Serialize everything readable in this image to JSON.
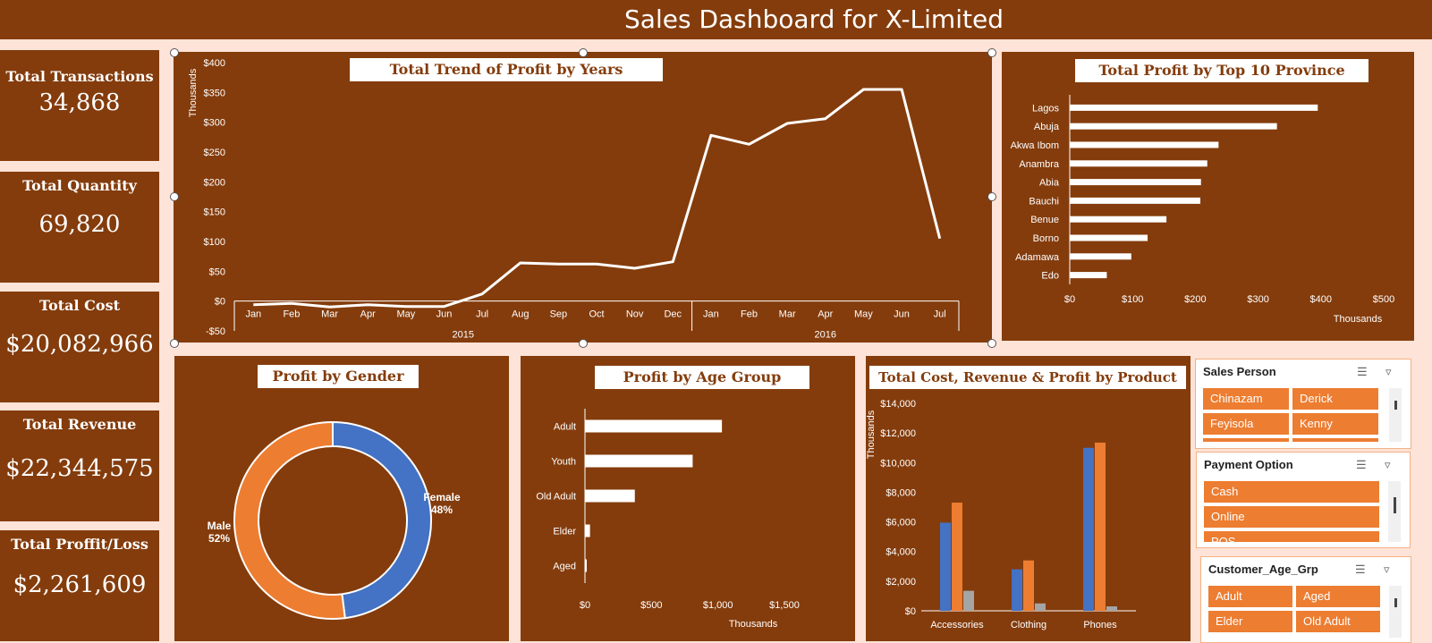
{
  "dashboard": {
    "title": "Sales Dashboard for X-Limited"
  },
  "kpis": [
    {
      "label": "Total Transactions",
      "value": "34,868"
    },
    {
      "label": "Total Quantity",
      "value": "69,820"
    },
    {
      "label": "Total Cost",
      "value": "$20,082,966"
    },
    {
      "label": "Total Revenue",
      "value": "$22,344,575"
    },
    {
      "label": "Total Proffit/Loss",
      "value": "$2,261,609"
    }
  ],
  "chart_data": [
    {
      "type": "line",
      "title": "Total Trend of Profit by Years",
      "ylabel": "Thousands",
      "ylim": [
        -50,
        400
      ],
      "yticks": [
        "-$50",
        "$0",
        "$50",
        "$100",
        "$150",
        "$200",
        "$250",
        "$300",
        "$350",
        "$400"
      ],
      "x": [
        "Jan",
        "Feb",
        "Mar",
        "Apr",
        "May",
        "Jun",
        "Jul",
        "Aug",
        "Sep",
        "Oct",
        "Nov",
        "Dec",
        "Jan",
        "Feb",
        "Mar",
        "Apr",
        "May",
        "Jun",
        "Jul"
      ],
      "year_groups": [
        {
          "label": "2015",
          "count": 12
        },
        {
          "label": "2016",
          "count": 7
        }
      ],
      "values": [
        -6,
        -4,
        -10,
        -6,
        -9,
        -9,
        12,
        64,
        62,
        62,
        55,
        66,
        278,
        263,
        298,
        306,
        355,
        355,
        105
      ],
      "color": "#ffffff"
    },
    {
      "type": "bar",
      "orientation": "horizontal",
      "title": "Total Profit by Top 10 Province",
      "xlabel": "Thousands",
      "categories": [
        "Lagos",
        "Abuja",
        "Akwa Ibom",
        "Anambra",
        "Abia",
        "Bauchi",
        "Benue",
        "Borno",
        "Adamawa",
        "Edo"
      ],
      "values": [
        395,
        330,
        237,
        219,
        209,
        208,
        154,
        124,
        98,
        59
      ],
      "xlim": [
        0,
        500
      ],
      "xticks": [
        "$0",
        "$100",
        "$200",
        "$300",
        "$400",
        "$500"
      ]
    },
    {
      "type": "pie",
      "donut": true,
      "title": "Profit by Gender",
      "slices": [
        {
          "label": "Female",
          "pct_label": "48%",
          "value": 48,
          "color": "#4472c4"
        },
        {
          "label": "Male",
          "pct_label": "52%",
          "value": 52,
          "color": "#ed7d31"
        }
      ]
    },
    {
      "type": "bar",
      "orientation": "horizontal",
      "title": "Profit by Age Group",
      "xlabel": "Thousands",
      "categories": [
        "Adult",
        "Youth",
        "Old Adult",
        "Elder",
        "Aged"
      ],
      "values": [
        1030,
        810,
        375,
        38,
        10
      ],
      "xlim": [
        0,
        1500
      ],
      "xticks": [
        "$0",
        "$500",
        "$1,000",
        "$1,500"
      ]
    },
    {
      "type": "bar",
      "title": "Total  Cost, Revenue & Profit by Product",
      "ylabel": "Thousands",
      "ylim": [
        0,
        14000
      ],
      "yticks": [
        "$0",
        "$2,000",
        "$4,000",
        "$6,000",
        "$8,000",
        "$10,000",
        "$12,000",
        "$14,000"
      ],
      "categories": [
        "Accessories",
        "Clothing",
        "Phones"
      ],
      "series": [
        {
          "values": [
            5950,
            2800,
            11000
          ],
          "color": "#4472c4"
        },
        {
          "values": [
            7300,
            3400,
            11350
          ],
          "color": "#ed7d31"
        },
        {
          "values": [
            1350,
            500,
            300
          ],
          "color": "#a5a5a5"
        }
      ]
    }
  ],
  "slicers": [
    {
      "title": "Sales Person",
      "items": [
        "Chinazam",
        "Derick",
        "Feyisola",
        "Kenny"
      ]
    },
    {
      "title": "Payment Option",
      "items": [
        "Cash",
        "Online",
        "POS"
      ]
    },
    {
      "title": "Customer_Age_Grp",
      "items": [
        "Adult",
        "Aged",
        "Elder",
        "Old Adult"
      ]
    }
  ],
  "icons": {
    "multiselect": "multiselect-icon",
    "clear_filter": "clear-filter-icon"
  },
  "colors": {
    "panel": "#843c0c",
    "background": "#fde3d8",
    "accent": "#ed7d31",
    "blue": "#4472c4",
    "gray": "#a5a5a5"
  }
}
